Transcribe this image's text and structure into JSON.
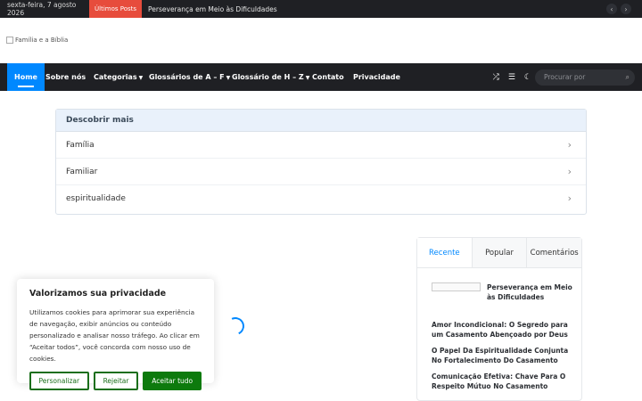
{
  "topbar": {
    "date": "sexta-feira, 7 agosto 2026",
    "latest_label": "Últimos Posts",
    "ticker": "Perseverança em Meio às Dificuldades",
    "prev_icon": "chevron-left",
    "next_icon": "chevron-right"
  },
  "logo": {
    "alt": "Família e a Bíblia"
  },
  "nav": {
    "items": [
      {
        "label": "Home"
      },
      {
        "label": "Sobre nós"
      },
      {
        "label": "Categorias"
      },
      {
        "label": "Glossários de A – F"
      },
      {
        "label": "Glossário de H – Z"
      },
      {
        "label": "Contato"
      },
      {
        "label": "Privacidade"
      }
    ],
    "search_placeholder": "Procurar por",
    "accent": "#0088ff"
  },
  "discover": {
    "title": "Descobrir mais",
    "items": [
      {
        "label": "Família"
      },
      {
        "label": "Familiar"
      },
      {
        "label": "espiritualidade"
      }
    ]
  },
  "widget": {
    "tabs": [
      {
        "label": "Recente"
      },
      {
        "label": "Popular"
      },
      {
        "label": "Comentários"
      }
    ],
    "featured": "Perseverança em Meio às Dificuldades",
    "posts": [
      "Amor Incondicional: O Segredo para um Casamento Abençoado por Deus",
      "O Papel Da Espiritualidade Conjunta No Fortalecimento Do Casamento",
      "Comunicação Efetiva: Chave Para O Respeito Mútuo No Casamento"
    ]
  },
  "cookie": {
    "title": "Valorizamos sua privacidade",
    "text": "Utilizamos cookies para aprimorar sua experiência de navegação, exibir anúncios ou conteúdo personalizado e analisar nosso tráfego. Ao clicar em “Aceitar todos”, você concorda com nosso uso de cookies.",
    "customize": "Personalizar",
    "reject": "Rejeitar",
    "accept": "Aceitar tudo",
    "accent": "#0d7a0d"
  }
}
